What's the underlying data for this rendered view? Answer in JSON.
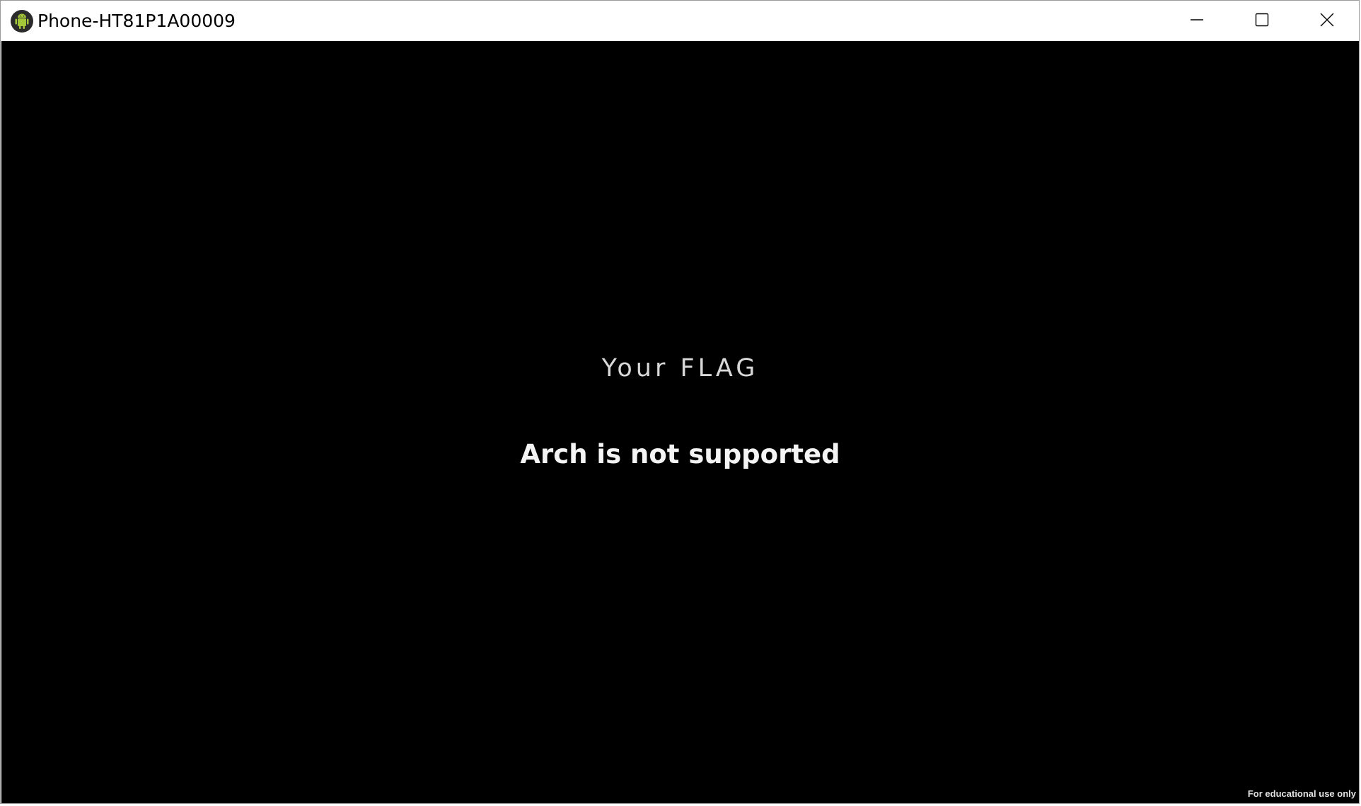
{
  "window": {
    "title": "Phone-HT81P1A00009",
    "app_icon": "android-icon",
    "controls": {
      "minimize_icon": "minimize-icon",
      "maximize_icon": "maximize-icon",
      "close_icon": "close-icon"
    }
  },
  "screen": {
    "background": "#000000",
    "flag_text": "Your FLAG",
    "message": "Arch is not supported",
    "watermark": "For educational use only"
  },
  "colors": {
    "android_green": "#a4c639"
  }
}
